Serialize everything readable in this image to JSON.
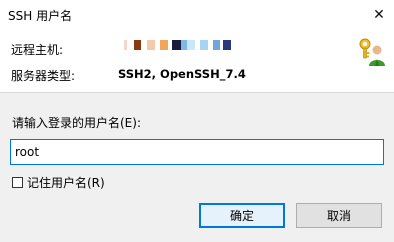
{
  "window": {
    "title": "SSH 用户名",
    "close_glyph": "✕"
  },
  "info": {
    "host_label": "远程主机:",
    "type_label": "服务器类型:",
    "type_value": "SSH2, OpenSSH_7.4"
  },
  "form": {
    "prompt_label": "请输入登录的用户名(E):",
    "username_value": "root",
    "remember_label": "记住用户名(R)"
  },
  "buttons": {
    "ok": "确定",
    "cancel": "取消"
  }
}
